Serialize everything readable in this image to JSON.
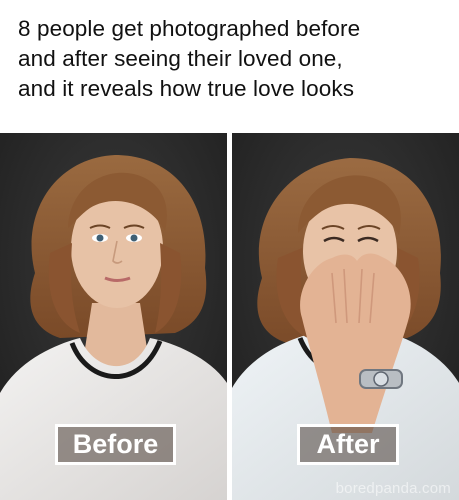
{
  "caption": {
    "text": "8 people get photographed before\nand after seeing their loved one,\nand it reveals how true love looks"
  },
  "photos": {
    "before_label": "Before",
    "after_label": "After"
  },
  "watermark": {
    "text": "boredpanda.com"
  },
  "colors": {
    "background": "#2a2a2a",
    "hair": "#8a5a35",
    "skin": "#e7c2a6",
    "shirt": "#e9e7e6",
    "label_overlay": "#4e423a"
  }
}
